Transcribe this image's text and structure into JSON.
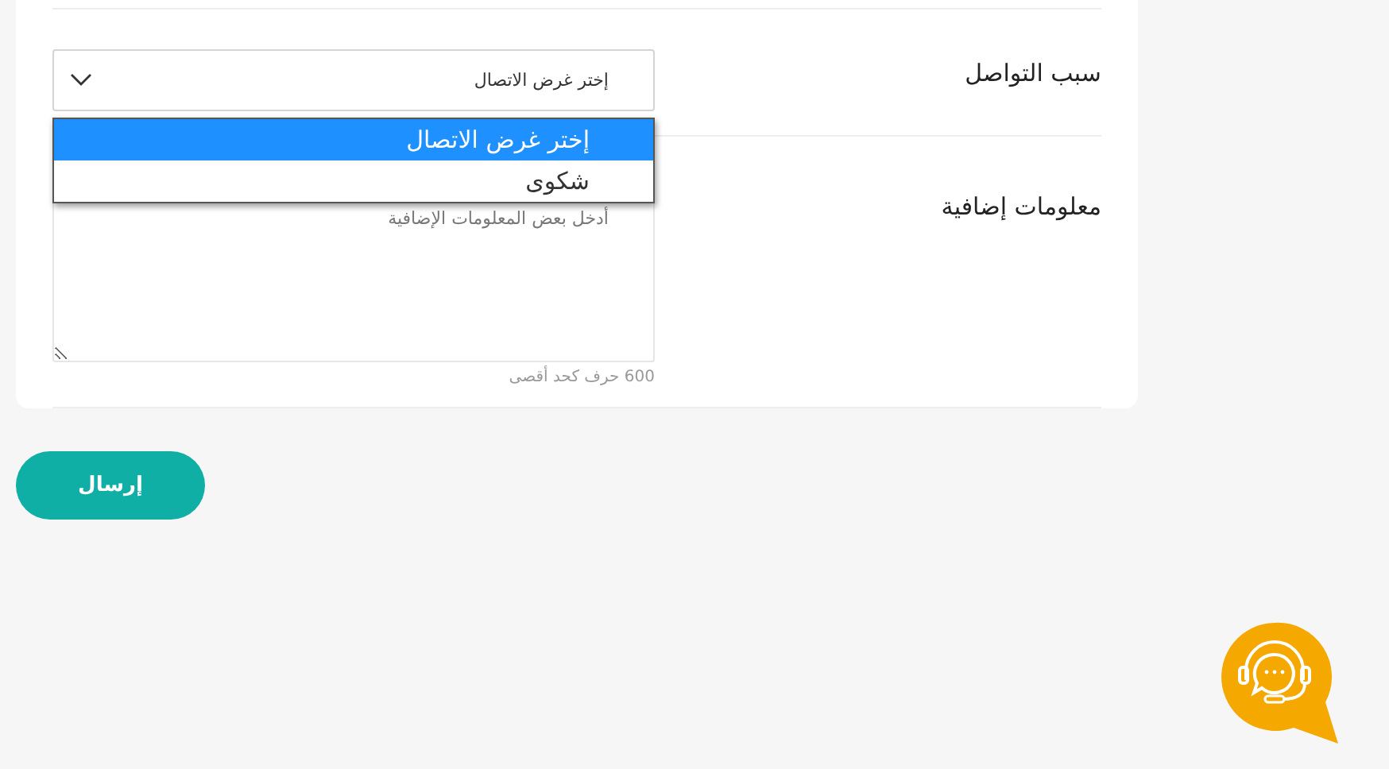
{
  "form": {
    "fields": [
      {
        "kind": "select",
        "label": "سبب التواصل",
        "value": "إختر غرض الاتصال",
        "expanded": true,
        "options": [
          {
            "label": "إختر غرض الاتصال",
            "selected": true
          },
          {
            "label": "شكوى",
            "selected": false
          }
        ]
      },
      {
        "kind": "textarea",
        "label": "معلومات إضافية",
        "placeholder": "أدخل بعض المعلومات الإضافية",
        "hint": "600 حرف كحد أقصى"
      }
    ]
  },
  "submit_button": "إرسال"
}
